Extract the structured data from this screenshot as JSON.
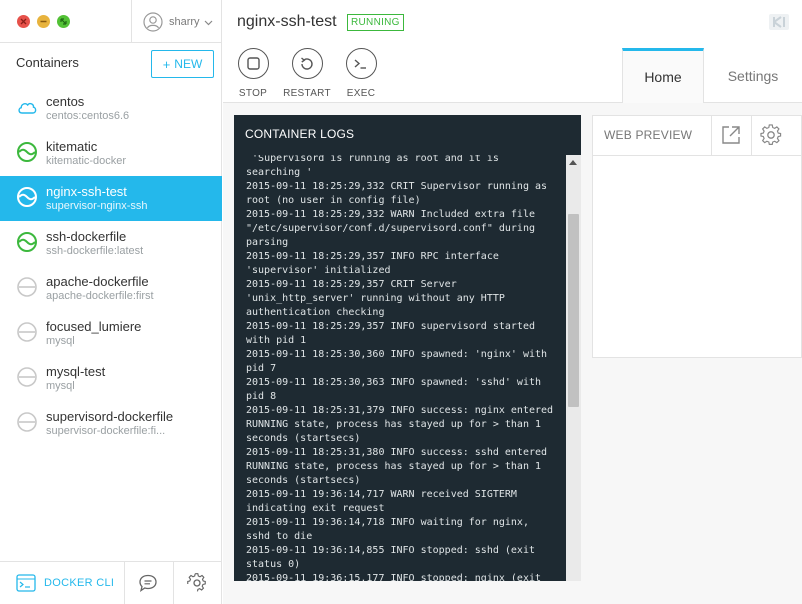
{
  "sidebar": {
    "user": {
      "name": "sharry"
    },
    "containers_title": "Containers",
    "new_button": {
      "plus": "+",
      "label": "NEW"
    },
    "items": [
      {
        "name": "centos",
        "image": "centos:centos6.6",
        "status": "downloading"
      },
      {
        "name": "kitematic",
        "image": "kitematic-docker",
        "status": "running"
      },
      {
        "name": "nginx-ssh-test",
        "image": "supervisor-nginx-ssh",
        "status": "running",
        "active": true
      },
      {
        "name": "ssh-dockerfile",
        "image": "ssh-dockerfile:latest",
        "status": "running"
      },
      {
        "name": "apache-dockerfile",
        "image": "apache-dockerfile:first",
        "status": "stopped"
      },
      {
        "name": "focused_lumiere",
        "image": "mysql",
        "status": "stopped"
      },
      {
        "name": "mysql-test",
        "image": "mysql",
        "status": "stopped"
      },
      {
        "name": "supervisord-dockerfile",
        "image": "supervisor-dockerfile:fi...",
        "status": "stopped"
      }
    ],
    "footer": {
      "docker_cli_label": "DOCKER CLI"
    }
  },
  "header": {
    "container_name": "nginx-ssh-test",
    "status_badge": "RUNNING",
    "actions": {
      "stop": "STOP",
      "restart": "RESTART",
      "exec": "EXEC"
    },
    "tabs": {
      "home": "Home",
      "settings": "Settings"
    }
  },
  "logs": {
    "title": "CONTAINER LOGS",
    "text": " 'Supervisord is running as root and it is searching '\n2015-09-11 18:25:29,332 CRIT Supervisor running as root (no user in config file)\n2015-09-11 18:25:29,332 WARN Included extra file \"/etc/supervisor/conf.d/supervisord.conf\" during parsing\n2015-09-11 18:25:29,357 INFO RPC interface 'supervisor' initialized\n2015-09-11 18:25:29,357 CRIT Server 'unix_http_server' running without any HTTP authentication checking\n2015-09-11 18:25:29,357 INFO supervisord started with pid 1\n2015-09-11 18:25:30,360 INFO spawned: 'nginx' with pid 7\n2015-09-11 18:25:30,363 INFO spawned: 'sshd' with pid 8\n2015-09-11 18:25:31,379 INFO success: nginx entered RUNNING state, process has stayed up for > than 1 seconds (startsecs)\n2015-09-11 18:25:31,380 INFO success: sshd entered RUNNING state, process has stayed up for > than 1 seconds (startsecs)\n2015-09-11 19:36:14,717 WARN received SIGTERM indicating exit request\n2015-09-11 19:36:14,718 INFO waiting for nginx, sshd to die\n2015-09-11 19:36:14,855 INFO stopped: sshd (exit status 0)\n2015-09-11 19:36:15,177 INFO stopped: nginx (exit"
  },
  "web_preview": {
    "title": "WEB PREVIEW"
  },
  "colors": {
    "accent": "#24b8eb",
    "running": "#3cb83d",
    "stopped": "#c8c8c8",
    "log_bg": "#1e2a32"
  }
}
